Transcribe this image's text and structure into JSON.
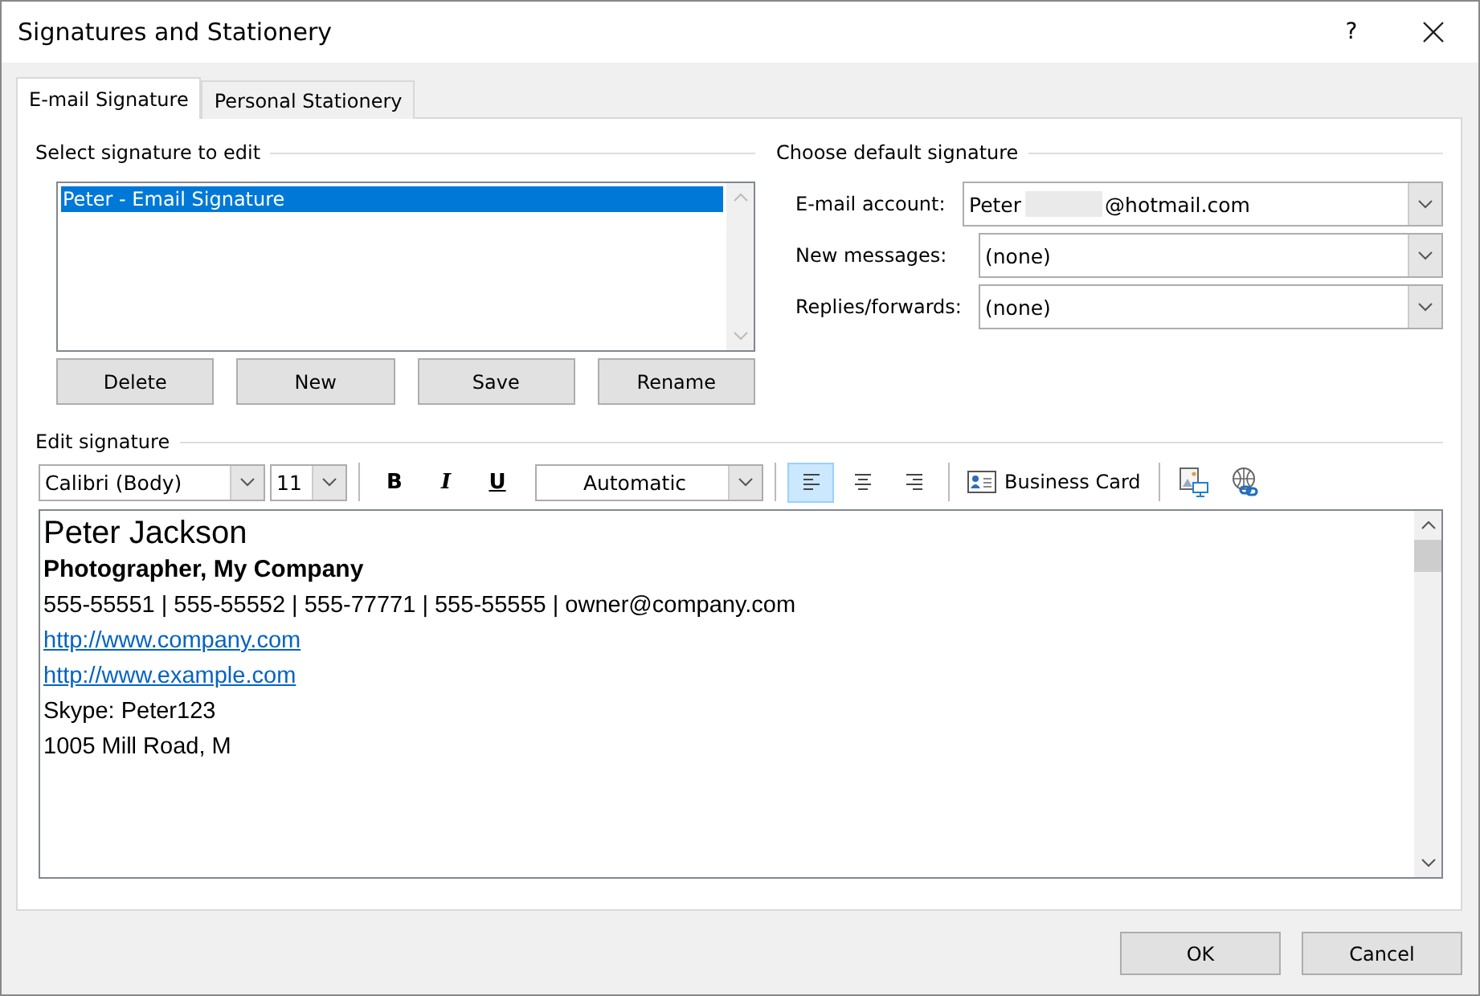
{
  "window": {
    "title": "Signatures and Stationery",
    "help": "?"
  },
  "tabs": [
    {
      "label": "E-mail Signature",
      "selected": true
    },
    {
      "label": "Personal Stationery",
      "selected": false
    }
  ],
  "select_signature": {
    "heading": "Select signature to edit",
    "items": [
      {
        "label": "Peter - Email Signature",
        "selected": true
      }
    ],
    "buttons": [
      "Delete",
      "New",
      "Save",
      "Rename"
    ]
  },
  "default_signature": {
    "heading": "Choose default signature",
    "fields": [
      {
        "label": "E-mail account:",
        "value_before": "Peter",
        "value_after": "@hotmail.com",
        "redacted": true
      },
      {
        "label": "New messages:",
        "value_before": "(none)",
        "redacted": false
      },
      {
        "label": "Replies/forwards:",
        "value_before": "(none)",
        "redacted": false
      }
    ]
  },
  "edit_signature": {
    "heading": "Edit signature",
    "font": "Calibri (Body)",
    "size": "11",
    "bold": "B",
    "italic": "I",
    "underline": "U",
    "color_label": "Automatic",
    "align": [
      {
        "kind": "left",
        "selected": true
      },
      {
        "kind": "center",
        "selected": false
      },
      {
        "kind": "right",
        "selected": false
      }
    ],
    "business_card": "Business Card",
    "lines": [
      {
        "kind": "name",
        "text": "Peter Jackson"
      },
      {
        "kind": "title",
        "text": "Photographer, My Company"
      },
      {
        "kind": "text",
        "text": "555-55551 | 555-55552 | 555-77771 | 555-55555 | owner@company.com"
      },
      {
        "kind": "link",
        "text": "http://www.company.com"
      },
      {
        "kind": "link",
        "text": "http://www.example.com"
      },
      {
        "kind": "text",
        "text": "Skype: Peter123"
      },
      {
        "kind": "text",
        "text": "1005 Mill Road, M"
      }
    ]
  },
  "buttons": [
    "OK",
    "Cancel"
  ]
}
